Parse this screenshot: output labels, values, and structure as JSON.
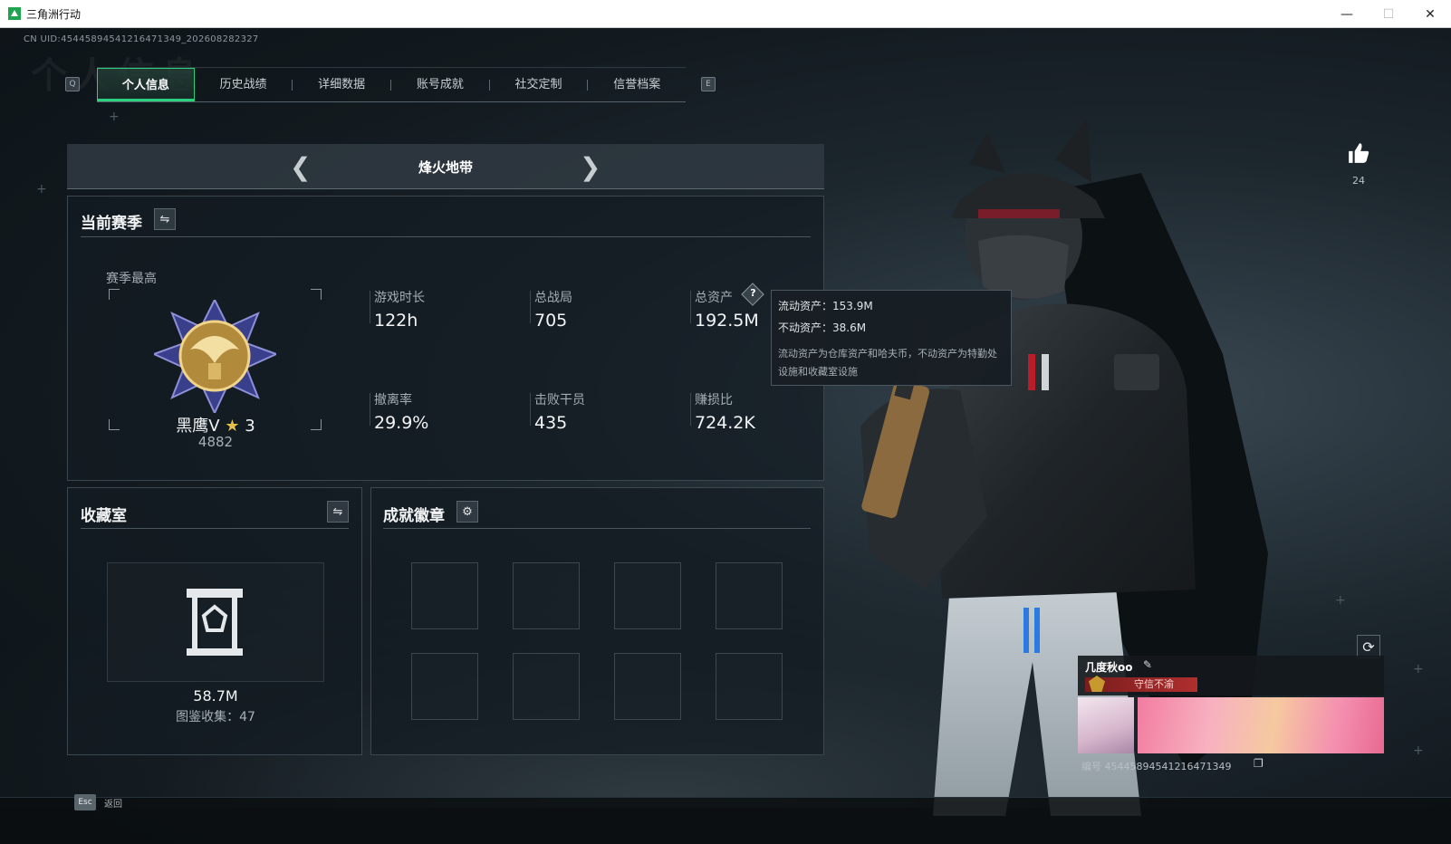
{
  "window": {
    "title": "三角洲行动",
    "controls": {
      "minimize": "—",
      "maximize": "☐",
      "close": "✕"
    }
  },
  "header": {
    "uid": "CN UID:45445894541216471349_202608282327",
    "watermark": "个人信息"
  },
  "tabs": {
    "prev_key": "Q",
    "next_key": "E",
    "items": [
      "个人信息",
      "历史战绩",
      "详细数据",
      "账号成就",
      "社交定制",
      "信誉档案"
    ],
    "active_index": 0
  },
  "mode": {
    "label": "烽火地带"
  },
  "season": {
    "title": "当前赛季",
    "best_label": "赛季最高",
    "rank_name": "黑鹰V",
    "rank_stars": "3",
    "rank_points": "4882",
    "stats": [
      {
        "label": "游戏时长",
        "value": "122h"
      },
      {
        "label": "总战局",
        "value": "705"
      },
      {
        "label": "总资产",
        "value": "192.5M"
      },
      {
        "label": "撤离率",
        "value": "29.9%"
      },
      {
        "label": "击败干员",
        "value": "435"
      },
      {
        "label": "赚损比",
        "value": "724.2K"
      }
    ],
    "help_icon": "question-icon"
  },
  "tooltip": {
    "liquid": "流动资产：153.9M",
    "fixed": "不动资产：38.6M",
    "desc": "流动资产为仓库资产和哈夫币，不动资产为特勤处设施和收藏室设施"
  },
  "collection": {
    "title": "收藏室",
    "value": "58.7M",
    "count_text": "图鉴收集：47"
  },
  "badges": {
    "title": "成就徽章",
    "slots": 8
  },
  "profile": {
    "likes": "24",
    "name": "几度秋oo",
    "motto": "守信不渝",
    "id_text": "编号 45445894541216471349"
  },
  "footer": {
    "esc_key": "Esc",
    "back_label": "返回"
  },
  "colors": {
    "accent": "#2ad07e",
    "motto_bg": "#b02e2e"
  }
}
